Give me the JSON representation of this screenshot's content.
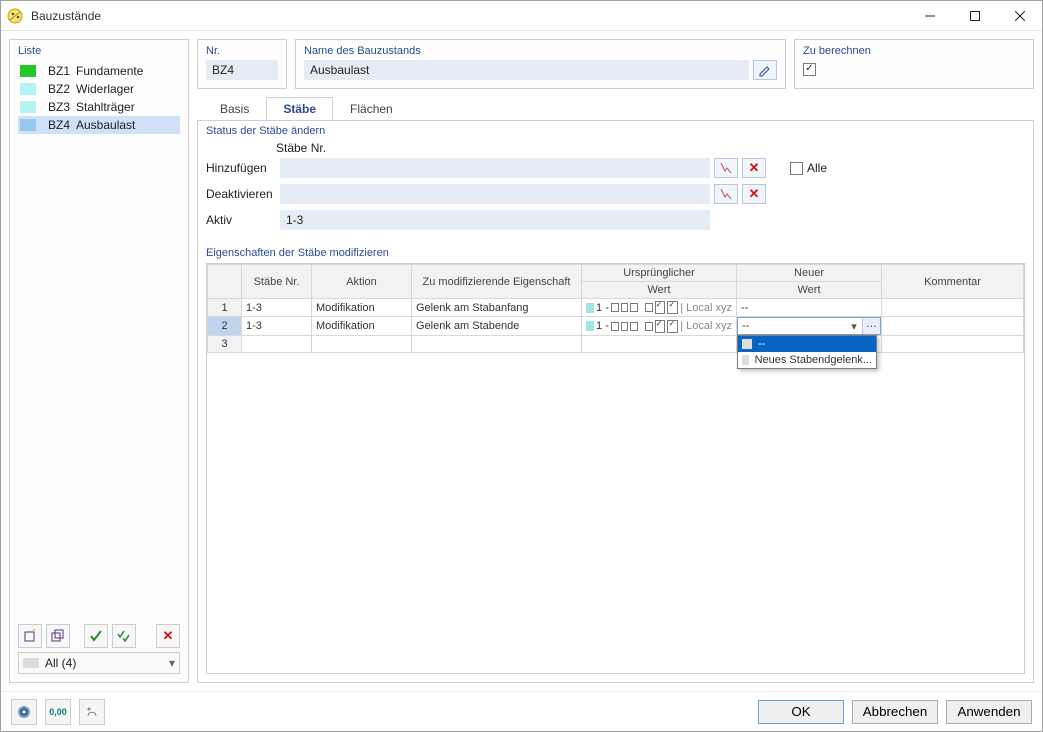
{
  "window": {
    "title": "Bauzustände"
  },
  "sidebar": {
    "title": "Liste",
    "items": [
      {
        "code": "BZ1",
        "label": "Fundamente",
        "color": "sw-green"
      },
      {
        "code": "BZ2",
        "label": "Widerlager",
        "color": "sw-cyan"
      },
      {
        "code": "BZ3",
        "label": "Stahlträger",
        "color": "sw-cyan"
      },
      {
        "code": "BZ4",
        "label": "Ausbaulast",
        "color": "sw-blue"
      }
    ],
    "selected_index": 3,
    "filter": "All (4)"
  },
  "header": {
    "nr_label": "Nr.",
    "nr_value": "BZ4",
    "name_label": "Name des Bauzustands",
    "name_value": "Ausbaulast",
    "calc_label": "Zu berechnen",
    "calc_checked": true
  },
  "tabs": {
    "items": [
      "Basis",
      "Stäbe",
      "Flächen"
    ],
    "active": 1
  },
  "status_section": {
    "title": "Status der Stäbe ändern",
    "col_label": "Stäbe Nr.",
    "add_label": "Hinzufügen",
    "deact_label": "Deaktivieren",
    "active_label": "Aktiv",
    "active_value": "1-3",
    "alle_label": "Alle"
  },
  "prop_section": {
    "title": "Eigenschaften der Stäbe modifizieren",
    "headers": {
      "staebe": "Stäbe Nr.",
      "aktion": "Aktion",
      "eigenschaft": "Zu modifizierende Eigenschaft",
      "urspr1": "Ursprünglicher",
      "urspr2": "Wert",
      "neu1": "Neuer",
      "neu2": "Wert",
      "kommentar": "Kommentar"
    },
    "rows": [
      {
        "idx": "1",
        "staebe": "1-3",
        "aktion": "Modifikation",
        "eigenschaft": "Gelenk am Stabanfang",
        "urspr_num": "1 -",
        "urspr_suffix": "| Local xyz",
        "neu": "--"
      },
      {
        "idx": "2",
        "staebe": "1-3",
        "aktion": "Modifikation",
        "eigenschaft": "Gelenk am Stabende",
        "urspr_num": "1 -",
        "urspr_suffix": "| Local xyz",
        "neu": "--"
      },
      {
        "idx": "3"
      }
    ],
    "dropdown": {
      "options": [
        "--",
        "Neues Stabendgelenk..."
      ],
      "selected": 0
    }
  },
  "footer": {
    "ok": "OK",
    "cancel": "Abbrechen",
    "apply": "Anwenden",
    "numfmt_label": "0,00"
  }
}
